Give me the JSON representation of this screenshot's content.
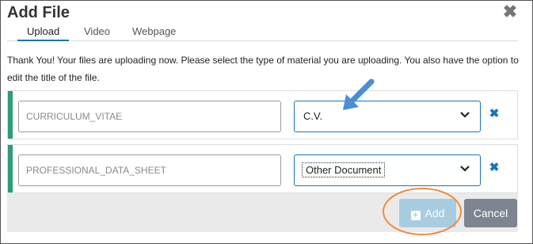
{
  "dialog": {
    "title": "Add File",
    "close_icon": "close-icon"
  },
  "tabs": [
    {
      "label": "Upload",
      "active": true
    },
    {
      "label": "Video",
      "active": false
    },
    {
      "label": "Webpage",
      "active": false
    }
  ],
  "message": "Thank You! Your files are uploading now. Please select the type of material you are uploading. You also have the option to edit the title of the file.",
  "files": [
    {
      "title_value": "CURRICULUM_VITAE",
      "type_value": "C.V."
    },
    {
      "title_value": "PROFESSIONAL_DATA_SHEET",
      "type_value": "Other Document"
    }
  ],
  "footer": {
    "add_label": "Add",
    "cancel_label": "Cancel"
  },
  "colors": {
    "accent_bar": "#2e9b7c",
    "select_border": "#1a74b8",
    "add_button": "#a8cde1",
    "cancel_button": "#7d8590",
    "annotation_circle": "#ef8a3e",
    "annotation_arrow": "#4a8fd6"
  }
}
